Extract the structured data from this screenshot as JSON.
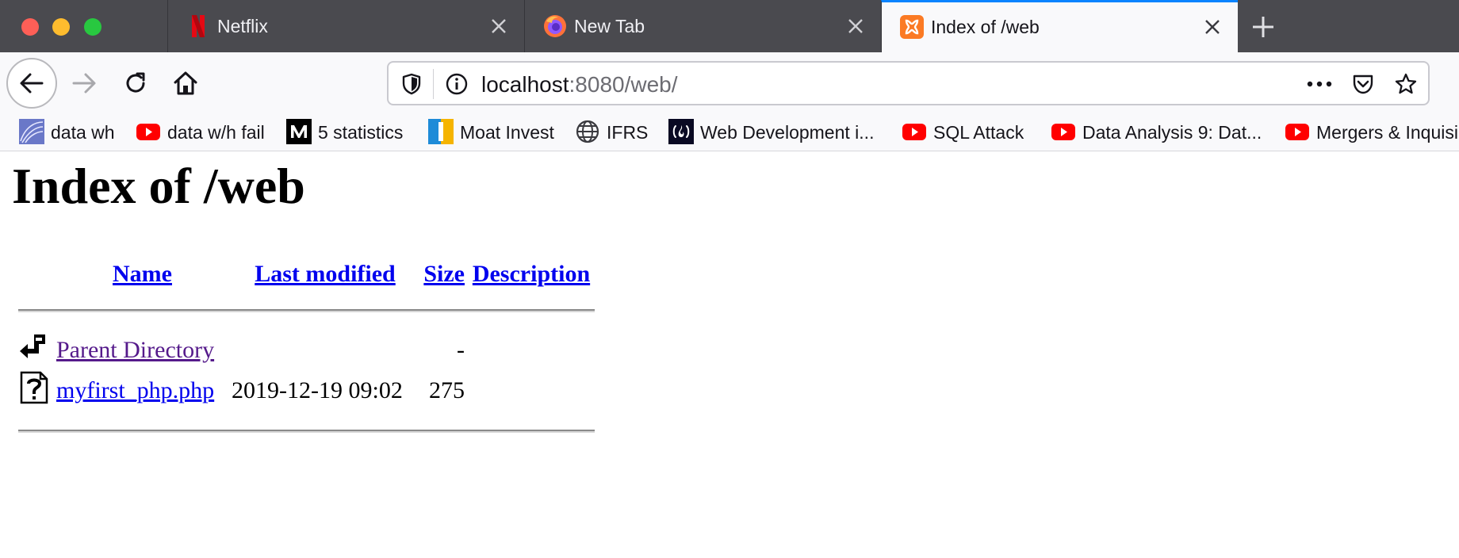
{
  "window": {
    "tabs": [
      {
        "title": "Netflix",
        "icon": "netflix-logo-icon",
        "active": false
      },
      {
        "title": "New Tab",
        "icon": "firefox-logo-icon",
        "active": false
      },
      {
        "title": "Index of /web",
        "icon": "xampp-logo-icon",
        "active": true
      }
    ]
  },
  "toolbar": {
    "url_host": "localhost",
    "url_rest": ":8080/web/"
  },
  "bookmarks": [
    {
      "label": "data wh",
      "icon": "bookmark-image-icon"
    },
    {
      "label": "data w/h fail",
      "icon": "youtube-icon"
    },
    {
      "label": "5 statistics",
      "icon": "medium-logo-icon"
    },
    {
      "label": "Moat Invest",
      "icon": "moat-invest-logo-icon"
    },
    {
      "label": "IFRS",
      "icon": "globe-icon"
    },
    {
      "label": "Web Development i...",
      "icon": "freecodecamp-icon"
    },
    {
      "label": "SQL Attack",
      "icon": "youtube-icon"
    },
    {
      "label": "Data Analysis 9: Dat...",
      "icon": "youtube-icon"
    },
    {
      "label": "Mergers & Inquisi",
      "icon": "youtube-icon"
    }
  ],
  "page": {
    "heading": "Index of /web",
    "columns": {
      "name": "Name",
      "last_modified": "Last modified",
      "size": "Size",
      "description": "Description"
    },
    "rows": [
      {
        "name": "Parent Directory",
        "modified": "",
        "size": "-",
        "description": "",
        "icon": "parent-directory-icon"
      },
      {
        "name": "myfirst_php.php",
        "modified": "2019-12-19 09:02",
        "size": "275",
        "description": "",
        "icon": "unknown-file-icon"
      }
    ]
  },
  "colors": {
    "tabstrip_bg": "#4a4a4f",
    "active_tab_accent": "#0a84ff",
    "link": "#0000ee",
    "visited_link": "#551a8b"
  }
}
